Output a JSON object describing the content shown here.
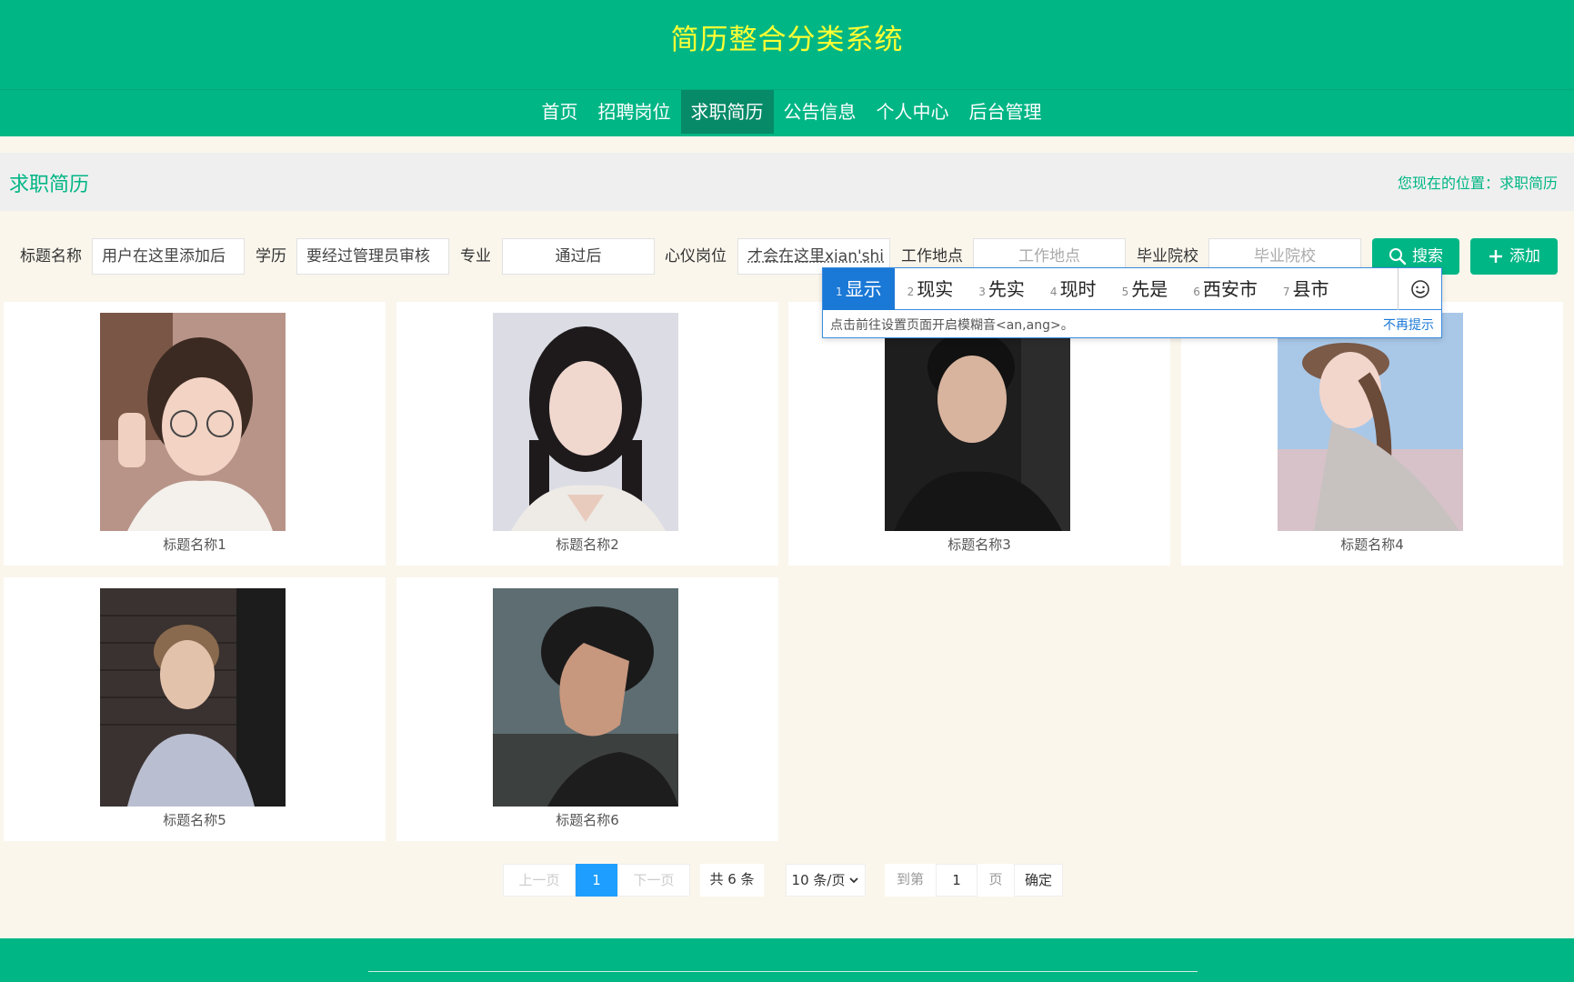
{
  "header": {
    "site_title": "简历整合分类系统"
  },
  "nav": [
    {
      "label": "首页"
    },
    {
      "label": "招聘岗位"
    },
    {
      "label": "求职简历",
      "active": true
    },
    {
      "label": "公告信息"
    },
    {
      "label": "个人中心"
    },
    {
      "label": "后台管理"
    }
  ],
  "section": {
    "title": "求职简历",
    "breadcrumb": "您现在的位置：求职简历"
  },
  "search": {
    "title_label": "标题名称",
    "title_value": "用户在这里添加后",
    "edu_label": "学历",
    "edu_value": "要经过管理员审核",
    "major_label": "专业",
    "major_value": "通过后",
    "position_label": "心仪岗位",
    "position_value": "才会在这里xian'shi",
    "location_label": "工作地点",
    "location_placeholder": "工作地点",
    "school_label": "毕业院校",
    "school_placeholder": "毕业院校",
    "search_button": "搜索",
    "add_button": "添加"
  },
  "ime": {
    "candidates": [
      {
        "num": "1",
        "text": "显示"
      },
      {
        "num": "2",
        "text": "现实"
      },
      {
        "num": "3",
        "text": "先实"
      },
      {
        "num": "4",
        "text": "现时"
      },
      {
        "num": "5",
        "text": "先是"
      },
      {
        "num": "6",
        "text": "西安市"
      },
      {
        "num": "7",
        "text": "县市"
      }
    ],
    "tip": "点击前往设置页面开启模糊音<an,ang>。",
    "dismiss": "不再提示"
  },
  "cards": [
    {
      "caption": "标题名称1"
    },
    {
      "caption": "标题名称2"
    },
    {
      "caption": "标题名称3"
    },
    {
      "caption": "标题名称4"
    },
    {
      "caption": "标题名称5"
    },
    {
      "caption": "标题名称6"
    }
  ],
  "pagination": {
    "prev": "上一页",
    "current": "1",
    "next": "下一页",
    "total": "共 6 条",
    "page_size": "10 条/页",
    "goto_label": "到第",
    "goto_value": "1",
    "page_unit": "页",
    "confirm": "确定"
  },
  "colors": {
    "primary": "#00b685",
    "title_yellow": "#ffff33",
    "nav_active": "#068a68",
    "page_bg": "#faf6ec",
    "ime_blue": "#1a78d6"
  }
}
